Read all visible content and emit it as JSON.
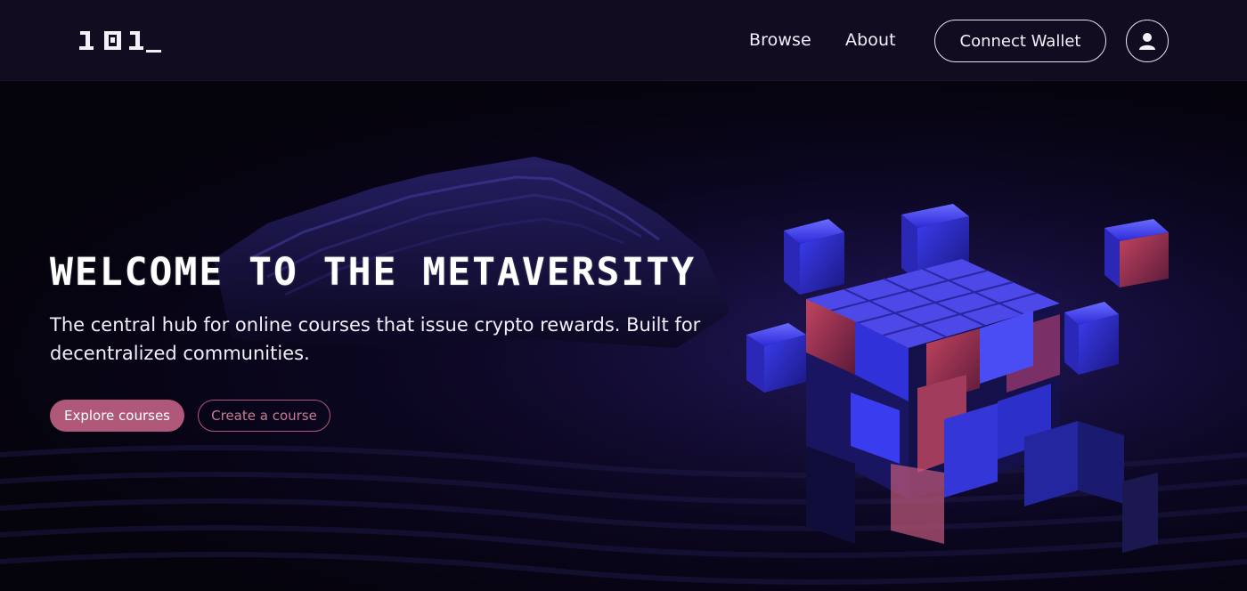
{
  "nav": {
    "logo_text": "101",
    "links": [
      {
        "label": "Browse"
      },
      {
        "label": "About"
      }
    ],
    "connect_wallet_label": "Connect Wallet",
    "profile_icon": "user-icon"
  },
  "hero": {
    "title": "WELCOME TO THE METAVERSITY",
    "subtitle": "The central hub for online courses that issue crypto rewards. Built for decentralized communities.",
    "primary_button_label": "Explore courses",
    "secondary_button_label": "Create a course",
    "background_image": "abstract-3d-cubes-illustration"
  },
  "colors": {
    "nav_background": "#110c1f",
    "hero_background": "#07040f",
    "accent": "#b0587a",
    "cube_blue": "#3b3df0",
    "cube_red": "#c2445f"
  }
}
